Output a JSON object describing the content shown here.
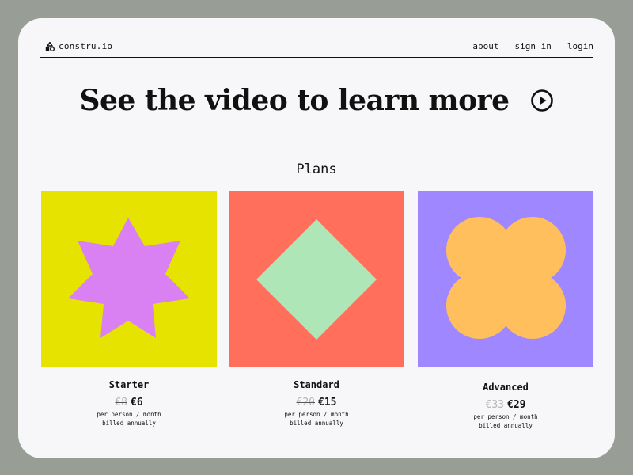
{
  "brand": {
    "name": "constru.io",
    "icon": "shapes-logo-icon"
  },
  "nav": {
    "links": [
      "about",
      "sign in",
      "login"
    ]
  },
  "hero": {
    "title": "See the video to learn more",
    "icon": "play-circle-icon"
  },
  "plans": {
    "title": "Plans",
    "items": [
      {
        "name": "Starter",
        "old_price": "€8",
        "new_price": "€6",
        "note_line1": "per person / month",
        "note_line2": "billed annually",
        "art": {
          "shape": "star-shape",
          "bg": "#e6e300",
          "fg": "#d981f2"
        }
      },
      {
        "name": "Standard",
        "old_price": "€20",
        "new_price": "€15",
        "note_line1": "per person / month",
        "note_line2": "billed annually",
        "art": {
          "shape": "diamond-shape",
          "bg": "#ff6f5c",
          "fg": "#aee6b8"
        }
      },
      {
        "name": "Advanced",
        "old_price": "€33",
        "new_price": "€29",
        "note_line1": "per person / month",
        "note_line2": "billed annually",
        "art": {
          "shape": "flower-shape",
          "bg": "#9f87ff",
          "fg": "#ffbf5c"
        }
      }
    ]
  },
  "colors": {
    "page_bg": "#989d96",
    "frame_bg": "#f7f7f9",
    "text": "#111111",
    "muted": "#b5b5b5"
  }
}
